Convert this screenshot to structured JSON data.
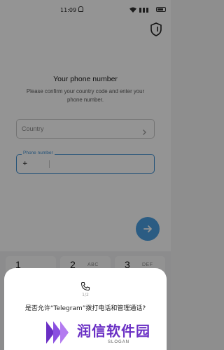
{
  "status_bar": {
    "time": "11:09"
  },
  "screen": {
    "title": "Your phone number",
    "subtitle": "Please confirm your country code and enter your phone number.",
    "country_placeholder": "Country",
    "phone_label": "Phone number",
    "phone_prefix": "+"
  },
  "keypad": {
    "keys": [
      {
        "number": "1",
        "letters": ""
      },
      {
        "number": "2",
        "letters": "ABC"
      },
      {
        "number": "3",
        "letters": "DEF"
      }
    ]
  },
  "dialog": {
    "count": "1/2",
    "message": "是否允许“Telegram”拨打电话和管理通话?"
  },
  "watermark": {
    "name": "润信软件园",
    "slogan": "SLOGAN"
  },
  "colors": {
    "accent": "#3f8fd0",
    "fab": "#4b9fe2",
    "watermark": "#6a2fc4"
  },
  "icons": [
    "bell-icon",
    "wifi-icon",
    "signal-icon",
    "battery-icon",
    "shield-icon",
    "chevron-right-icon",
    "arrow-right-icon",
    "phone-icon"
  ]
}
